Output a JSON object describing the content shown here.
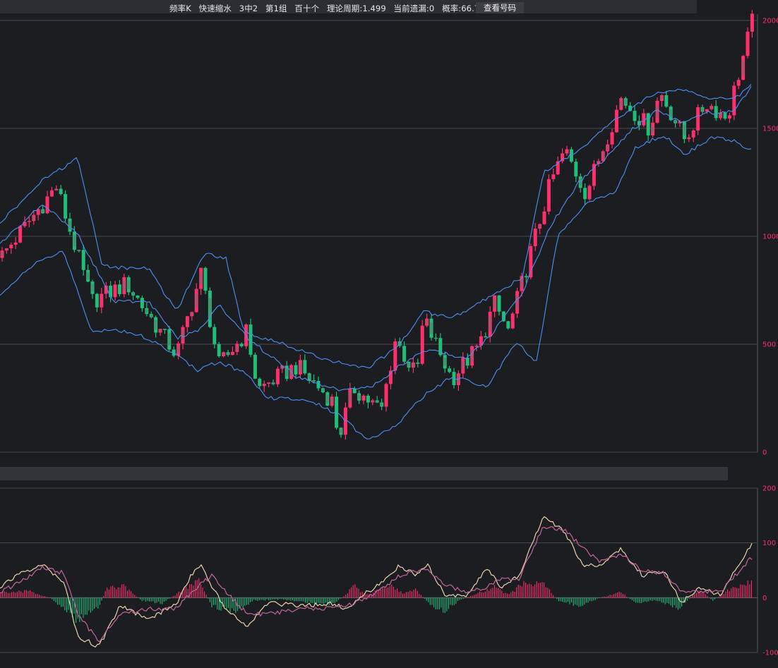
{
  "header": {
    "items": [
      "频率K",
      "快速缩水",
      "3中2",
      "第1组",
      "百十个",
      "理论周期:1.499",
      "当前遗漏:0",
      "概率:66.7%"
    ],
    "button_label": "查看号码"
  },
  "colors": {
    "background": "#1c1d21",
    "up": "#ff2f6d",
    "down": "#1fbf7a",
    "band": "#4f8ff0",
    "macd_fast": "#e8d2b0",
    "macd_slow": "#c2669b",
    "tick_label": "#ff2f6d"
  },
  "chart_data": [
    {
      "type": "candlestick",
      "title": "",
      "ylim": [
        0,
        2000
      ],
      "y_ticks": [
        "0",
        "500",
        "1000",
        "1500",
        "2000"
      ],
      "grid": true,
      "series": [
        {
          "name": "",
          "style": "brick-candles",
          "x_range": [
            0,
            1066
          ],
          "close_path": [
            [
              0,
              900
            ],
            [
              80,
              1230
            ],
            [
              130,
              700
            ],
            [
              180,
              780
            ],
            [
              250,
              450
            ],
            [
              285,
              830
            ],
            [
              310,
              400
            ],
            [
              350,
              560
            ],
            [
              365,
              290
            ],
            [
              420,
              400
            ],
            [
              470,
              240
            ],
            [
              480,
              70
            ],
            [
              500,
              300
            ],
            [
              540,
              190
            ],
            [
              560,
              520
            ],
            [
              590,
              350
            ],
            [
              600,
              620
            ],
            [
              640,
              340
            ],
            [
              680,
              500
            ],
            [
              700,
              690
            ],
            [
              720,
              560
            ],
            [
              780,
              1250
            ],
            [
              800,
              1400
            ],
            [
              830,
              1200
            ],
            [
              880,
              1640
            ],
            [
              920,
              1500
            ],
            [
              935,
              1670
            ],
            [
              970,
              1450
            ],
            [
              1000,
              1620
            ],
            [
              1030,
              1550
            ],
            [
              1066,
              2000
            ]
          ]
        },
        {
          "name": "",
          "style": "band-upper",
          "path": [
            [
              0,
              1060
            ],
            [
              60,
              1260
            ],
            [
              110,
              1360
            ],
            [
              145,
              860
            ],
            [
              210,
              850
            ],
            [
              250,
              650
            ],
            [
              290,
              920
            ],
            [
              320,
              900
            ],
            [
              345,
              560
            ],
            [
              410,
              490
            ],
            [
              470,
              420
            ],
            [
              520,
              390
            ],
            [
              560,
              480
            ],
            [
              600,
              650
            ],
            [
              640,
              620
            ],
            [
              700,
              730
            ],
            [
              740,
              810
            ],
            [
              770,
              1300
            ],
            [
              820,
              1400
            ],
            [
              880,
              1560
            ],
            [
              930,
              1670
            ],
            [
              965,
              1680
            ],
            [
              1000,
              1640
            ],
            [
              1040,
              1640
            ],
            [
              1066,
              1700
            ]
          ]
        },
        {
          "name": "",
          "style": "band-middle",
          "path": [
            [
              0,
              960
            ],
            [
              60,
              1150
            ],
            [
              110,
              1010
            ],
            [
              160,
              700
            ],
            [
              210,
              700
            ],
            [
              250,
              530
            ],
            [
              280,
              560
            ],
            [
              310,
              680
            ],
            [
              350,
              530
            ],
            [
              420,
              350
            ],
            [
              480,
              290
            ],
            [
              530,
              310
            ],
            [
              570,
              410
            ],
            [
              610,
              480
            ],
            [
              660,
              430
            ],
            [
              700,
              560
            ],
            [
              740,
              740
            ],
            [
              780,
              1050
            ],
            [
              820,
              1250
            ],
            [
              860,
              1370
            ],
            [
              890,
              1480
            ],
            [
              930,
              1580
            ],
            [
              965,
              1530
            ],
            [
              1000,
              1570
            ],
            [
              1040,
              1580
            ],
            [
              1066,
              1700
            ]
          ]
        },
        {
          "name": "",
          "style": "band-lower",
          "path": [
            [
              0,
              720
            ],
            [
              50,
              880
            ],
            [
              90,
              930
            ],
            [
              130,
              560
            ],
            [
              160,
              570
            ],
            [
              200,
              540
            ],
            [
              250,
              450
            ],
            [
              280,
              380
            ],
            [
              310,
              420
            ],
            [
              350,
              360
            ],
            [
              380,
              250
            ],
            [
              440,
              240
            ],
            [
              480,
              170
            ],
            [
              520,
              60
            ],
            [
              560,
              120
            ],
            [
              600,
              260
            ],
            [
              640,
              350
            ],
            [
              690,
              300
            ],
            [
              730,
              510
            ],
            [
              760,
              420
            ],
            [
              790,
              1000
            ],
            [
              830,
              1150
            ],
            [
              870,
              1200
            ],
            [
              900,
              1410
            ],
            [
              940,
              1470
            ],
            [
              970,
              1380
            ],
            [
              1010,
              1460
            ],
            [
              1040,
              1440
            ],
            [
              1066,
              1400
            ]
          ]
        }
      ]
    },
    {
      "type": "macd",
      "title": "",
      "ylim": [
        -100,
        200
      ],
      "y_ticks": [
        "-100",
        "0",
        "100",
        "200"
      ],
      "grid": true,
      "series": [
        {
          "name": "",
          "style": "fast-line",
          "path": [
            [
              0,
              20
            ],
            [
              30,
              45
            ],
            [
              60,
              60
            ],
            [
              90,
              30
            ],
            [
              110,
              -70
            ],
            [
              140,
              -90
            ],
            [
              170,
              -15
            ],
            [
              210,
              -40
            ],
            [
              250,
              -10
            ],
            [
              270,
              40
            ],
            [
              285,
              60
            ],
            [
              300,
              20
            ],
            [
              320,
              -20
            ],
            [
              350,
              -50
            ],
            [
              380,
              -10
            ],
            [
              430,
              -15
            ],
            [
              470,
              -10
            ],
            [
              490,
              -20
            ],
            [
              520,
              10
            ],
            [
              545,
              30
            ],
            [
              565,
              60
            ],
            [
              590,
              40
            ],
            [
              605,
              60
            ],
            [
              630,
              5
            ],
            [
              660,
              5
            ],
            [
              690,
              55
            ],
            [
              710,
              20
            ],
            [
              735,
              40
            ],
            [
              770,
              150
            ],
            [
              800,
              120
            ],
            [
              825,
              60
            ],
            [
              850,
              60
            ],
            [
              880,
              90
            ],
            [
              910,
              40
            ],
            [
              940,
              50
            ],
            [
              965,
              -10
            ],
            [
              990,
              20
            ],
            [
              1020,
              5
            ],
            [
              1066,
              100
            ]
          ]
        },
        {
          "name": "",
          "style": "slow-line",
          "path": [
            [
              0,
              10
            ],
            [
              30,
              30
            ],
            [
              60,
              55
            ],
            [
              90,
              45
            ],
            [
              110,
              -30
            ],
            [
              140,
              -80
            ],
            [
              170,
              -30
            ],
            [
              210,
              -20
            ],
            [
              250,
              -20
            ],
            [
              270,
              10
            ],
            [
              300,
              40
            ],
            [
              320,
              10
            ],
            [
              350,
              -30
            ],
            [
              380,
              -30
            ],
            [
              430,
              -20
            ],
            [
              470,
              -20
            ],
            [
              500,
              -10
            ],
            [
              520,
              0
            ],
            [
              545,
              20
            ],
            [
              565,
              40
            ],
            [
              590,
              50
            ],
            [
              605,
              50
            ],
            [
              630,
              25
            ],
            [
              660,
              10
            ],
            [
              690,
              20
            ],
            [
              710,
              35
            ],
            [
              735,
              35
            ],
            [
              770,
              130
            ],
            [
              800,
              125
            ],
            [
              825,
              90
            ],
            [
              850,
              65
            ],
            [
              880,
              80
            ],
            [
              910,
              50
            ],
            [
              940,
              45
            ],
            [
              965,
              10
            ],
            [
              990,
              10
            ],
            [
              1020,
              10
            ],
            [
              1066,
              75
            ]
          ]
        },
        {
          "name": "",
          "style": "histogram",
          "path": [
            [
              0,
              10
            ],
            [
              40,
              12
            ],
            [
              70,
              0
            ],
            [
              80,
              -10
            ],
            [
              110,
              -40
            ],
            [
              140,
              -20
            ],
            [
              150,
              15
            ],
            [
              175,
              22
            ],
            [
              200,
              -5
            ],
            [
              230,
              -10
            ],
            [
              260,
              15
            ],
            [
              280,
              35
            ],
            [
              300,
              -15
            ],
            [
              330,
              -25
            ],
            [
              360,
              -5
            ],
            [
              400,
              -3
            ],
            [
              430,
              -8
            ],
            [
              470,
              -12
            ],
            [
              490,
              5
            ],
            [
              500,
              22
            ],
            [
              520,
              5
            ],
            [
              555,
              22
            ],
            [
              570,
              8
            ],
            [
              590,
              15
            ],
            [
              610,
              -15
            ],
            [
              630,
              -25
            ],
            [
              650,
              -5
            ],
            [
              680,
              10
            ],
            [
              700,
              20
            ],
            [
              720,
              5
            ],
            [
              740,
              25
            ],
            [
              770,
              25
            ],
            [
              790,
              -5
            ],
            [
              820,
              -15
            ],
            [
              850,
              0
            ],
            [
              880,
              10
            ],
            [
              900,
              -10
            ],
            [
              930,
              -5
            ],
            [
              960,
              -20
            ],
            [
              990,
              15
            ],
            [
              1010,
              -5
            ],
            [
              1040,
              20
            ],
            [
              1066,
              30
            ]
          ]
        }
      ]
    }
  ]
}
